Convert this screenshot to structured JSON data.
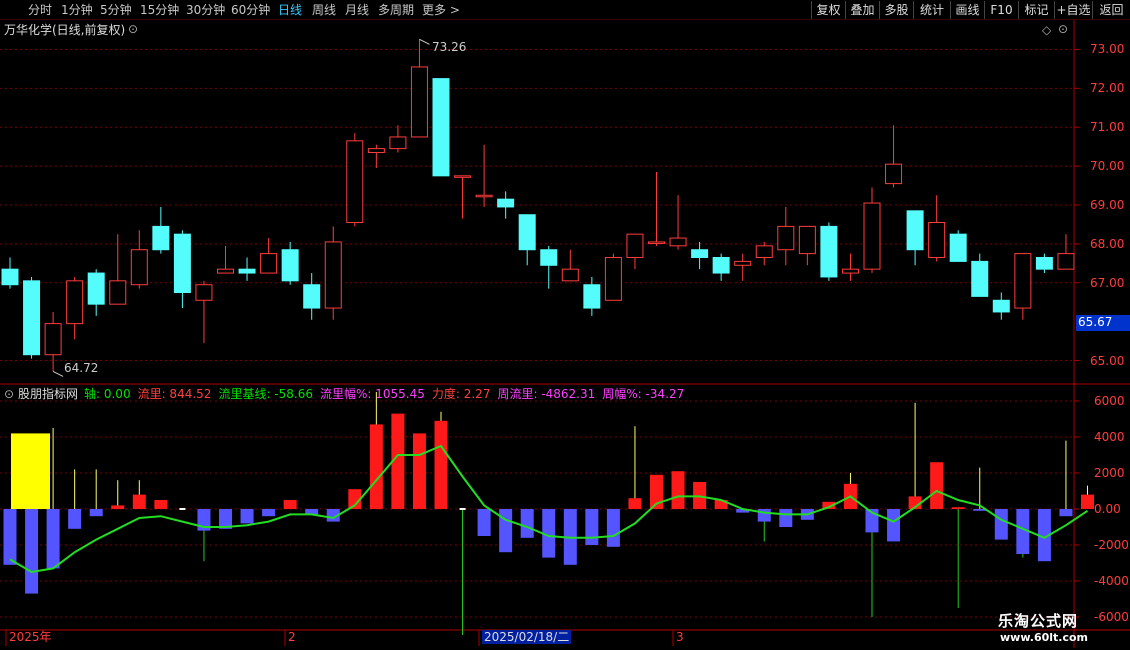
{
  "toolbar": {
    "periods": [
      {
        "label": "分时",
        "active": false
      },
      {
        "label": "1分钟",
        "active": false
      },
      {
        "label": "5分钟",
        "active": false
      },
      {
        "label": "15分钟",
        "active": false
      },
      {
        "label": "30分钟",
        "active": false
      },
      {
        "label": "60分钟",
        "active": false
      },
      {
        "label": "日线",
        "active": true
      },
      {
        "label": "周线",
        "active": false
      },
      {
        "label": "月线",
        "active": false
      },
      {
        "label": "多周期",
        "active": false
      },
      {
        "label": "更多 >",
        "active": false
      }
    ],
    "buttons": [
      "复权",
      "叠加",
      "多股",
      "统计",
      "画线",
      "F10",
      "标记",
      "+自选",
      "返回"
    ]
  },
  "main_title": "万华化学(日线,前复权)",
  "indicator": {
    "name": "股朋指标网",
    "fields": [
      {
        "label": "轴",
        "value": "0.00",
        "color": "#00e000"
      },
      {
        "label": "流里",
        "value": "844.52",
        "color": "#ff4040"
      },
      {
        "label": "流里基线",
        "value": "-58.66",
        "color": "#00e000"
      },
      {
        "label": "流里幅%",
        "value": "1055.45",
        "color": "#ff40ff"
      },
      {
        "label": "力度",
        "value": "2.27",
        "color": "#ff4040"
      },
      {
        "label": "周流里",
        "value": "-4862.31",
        "color": "#ff40ff"
      },
      {
        "label": "周幅%",
        "value": "-34.27",
        "color": "#ff40ff"
      }
    ]
  },
  "price_axis": [
    "73.00",
    "72.00",
    "71.00",
    "70.00",
    "69.00",
    "68.00",
    "67.00",
    "65.00"
  ],
  "current_price": "65.67",
  "high_marker": "73.26",
  "low_marker": "64.72",
  "vol_axis": [
    "6000",
    "4000",
    "2000",
    "0.00",
    "-2000",
    "-4000",
    "-6000"
  ],
  "date_axis": [
    "2025年",
    "2",
    "2025/02/18/二",
    "3"
  ],
  "watermark": {
    "title": "乐淘公式网",
    "url": "www.60lt.com"
  },
  "colors": {
    "up": "#ff3c3c",
    "down": "#54fcfc",
    "bg": "#000000",
    "grid": "#7a0000",
    "ind_up": "#ff1a1a",
    "ind_down": "#5555ff",
    "baseline": "#22dd22",
    "highlight": "#ffff00"
  },
  "chart_data": {
    "type": "candlestick",
    "candles": [
      {
        "o": 67.35,
        "h": 67.65,
        "l": 66.85,
        "c": 66.95
      },
      {
        "o": 67.05,
        "h": 67.15,
        "l": 65.05,
        "c": 65.15
      },
      {
        "o": 65.15,
        "h": 66.25,
        "l": 64.72,
        "c": 65.95
      },
      {
        "o": 65.95,
        "h": 67.15,
        "l": 65.55,
        "c": 67.05
      },
      {
        "o": 67.25,
        "h": 67.35,
        "l": 66.15,
        "c": 66.45
      },
      {
        "o": 66.45,
        "h": 68.25,
        "l": 66.45,
        "c": 67.05
      },
      {
        "o": 66.95,
        "h": 68.35,
        "l": 66.85,
        "c": 67.85
      },
      {
        "o": 68.45,
        "h": 68.95,
        "l": 67.75,
        "c": 67.85
      },
      {
        "o": 68.25,
        "h": 68.35,
        "l": 66.35,
        "c": 66.75
      },
      {
        "o": 66.55,
        "h": 67.05,
        "l": 65.45,
        "c": 66.95
      },
      {
        "o": 67.25,
        "h": 67.95,
        "l": 67.25,
        "c": 67.35
      },
      {
        "o": 67.35,
        "h": 67.65,
        "l": 67.05,
        "c": 67.25
      },
      {
        "o": 67.25,
        "h": 68.15,
        "l": 67.25,
        "c": 67.75
      },
      {
        "o": 67.85,
        "h": 68.05,
        "l": 66.95,
        "c": 67.05
      },
      {
        "o": 66.95,
        "h": 67.25,
        "l": 66.05,
        "c": 66.35
      },
      {
        "o": 66.35,
        "h": 68.45,
        "l": 66.05,
        "c": 68.05
      },
      {
        "o": 68.55,
        "h": 70.85,
        "l": 68.45,
        "c": 70.65
      },
      {
        "o": 70.35,
        "h": 70.55,
        "l": 69.95,
        "c": 70.45
      },
      {
        "o": 70.45,
        "h": 71.05,
        "l": 70.35,
        "c": 70.75
      },
      {
        "o": 70.75,
        "h": 73.26,
        "l": 70.75,
        "c": 72.55
      },
      {
        "o": 72.25,
        "h": 72.25,
        "l": 69.75,
        "c": 69.75
      },
      {
        "o": 69.75,
        "h": 69.75,
        "l": 68.65,
        "c": 69.75
      },
      {
        "o": 69.25,
        "h": 70.55,
        "l": 68.95,
        "c": 69.25
      },
      {
        "o": 69.15,
        "h": 69.35,
        "l": 68.65,
        "c": 68.95
      },
      {
        "o": 68.75,
        "h": 68.75,
        "l": 67.45,
        "c": 67.85
      },
      {
        "o": 67.85,
        "h": 67.95,
        "l": 66.85,
        "c": 67.45
      },
      {
        "o": 67.05,
        "h": 67.85,
        "l": 67.05,
        "c": 67.35
      },
      {
        "o": 66.95,
        "h": 67.15,
        "l": 66.15,
        "c": 66.35
      },
      {
        "o": 66.55,
        "h": 67.75,
        "l": 66.55,
        "c": 67.65
      },
      {
        "o": 67.65,
        "h": 68.25,
        "l": 67.35,
        "c": 68.25
      },
      {
        "o": 68.05,
        "h": 69.85,
        "l": 67.95,
        "c": 68.05
      },
      {
        "o": 67.95,
        "h": 69.25,
        "l": 67.85,
        "c": 68.15
      },
      {
        "o": 67.85,
        "h": 68.05,
        "l": 67.35,
        "c": 67.65
      },
      {
        "o": 67.65,
        "h": 67.75,
        "l": 67.05,
        "c": 67.25
      },
      {
        "o": 67.45,
        "h": 67.75,
        "l": 67.05,
        "c": 67.55
      },
      {
        "o": 67.65,
        "h": 68.05,
        "l": 67.45,
        "c": 67.95
      },
      {
        "o": 67.85,
        "h": 68.95,
        "l": 67.45,
        "c": 68.45
      },
      {
        "o": 67.75,
        "h": 68.45,
        "l": 67.45,
        "c": 68.45
      },
      {
        "o": 68.45,
        "h": 68.55,
        "l": 67.05,
        "c": 67.15
      },
      {
        "o": 67.25,
        "h": 67.75,
        "l": 67.05,
        "c": 67.35
      },
      {
        "o": 67.35,
        "h": 69.45,
        "l": 67.25,
        "c": 69.05
      },
      {
        "o": 69.55,
        "h": 71.05,
        "l": 69.45,
        "c": 70.05
      },
      {
        "o": 68.85,
        "h": 68.85,
        "l": 67.45,
        "c": 67.85
      },
      {
        "o": 67.65,
        "h": 69.25,
        "l": 67.55,
        "c": 68.55
      },
      {
        "o": 68.25,
        "h": 68.35,
        "l": 67.55,
        "c": 67.55
      },
      {
        "o": 67.55,
        "h": 67.75,
        "l": 66.65,
        "c": 66.65
      },
      {
        "o": 66.55,
        "h": 66.75,
        "l": 66.05,
        "c": 66.25
      },
      {
        "o": 66.35,
        "h": 67.75,
        "l": 66.05,
        "c": 67.75
      },
      {
        "o": 67.65,
        "h": 67.75,
        "l": 67.25,
        "c": 67.35
      },
      {
        "o": 67.35,
        "h": 68.25,
        "l": 67.35,
        "c": 67.75
      }
    ],
    "indicator_bars": [
      -3100,
      -4700,
      -3300,
      -1100,
      -400,
      200,
      800,
      500,
      0,
      -1200,
      -1100,
      -800,
      -400,
      500,
      -300,
      -700,
      1100,
      4700,
      5300,
      4200,
      4900,
      0,
      -1500,
      -2400,
      -1600,
      -2700,
      -3100,
      -2000,
      -2100,
      600,
      1900,
      2100,
      1500,
      500,
      -200,
      -700,
      -1000,
      -600,
      400,
      1400,
      -1300,
      -1800,
      700,
      2600,
      100,
      -100,
      -1700,
      -2500,
      -2900,
      -400,
      800
    ],
    "indicator_spikes": [
      -2000,
      0,
      4500,
      2200,
      2200,
      1600,
      1600,
      0,
      0,
      -2900,
      0,
      0,
      0,
      0,
      0,
      0,
      0,
      6500,
      0,
      0,
      5400,
      -7000,
      0,
      0,
      0,
      0,
      0,
      0,
      0,
      4600,
      0,
      0,
      0,
      0,
      0,
      -1800,
      0,
      0,
      0,
      2000,
      -6000,
      0,
      5900,
      0,
      -5500,
      2300,
      0,
      -2700,
      0,
      3800,
      1300
    ],
    "baseline": [
      -2800,
      -3500,
      -3300,
      -2400,
      -1700,
      -1100,
      -500,
      -400,
      -700,
      -1000,
      -1000,
      -900,
      -700,
      -300,
      -300,
      -500,
      200,
      1600,
      3000,
      3000,
      3500,
      1800,
      200,
      -600,
      -1000,
      -1500,
      -1600,
      -1600,
      -1500,
      -800,
      300,
      700,
      700,
      500,
      0,
      -200,
      -300,
      -300,
      100,
      700,
      -200,
      -700,
      100,
      1000,
      500,
      200,
      -600,
      -1100,
      -1600,
      -900,
      -100
    ],
    "price_ylim": [
      64.5,
      73.5
    ],
    "indicator_ylim": [
      -6500,
      6500
    ]
  }
}
